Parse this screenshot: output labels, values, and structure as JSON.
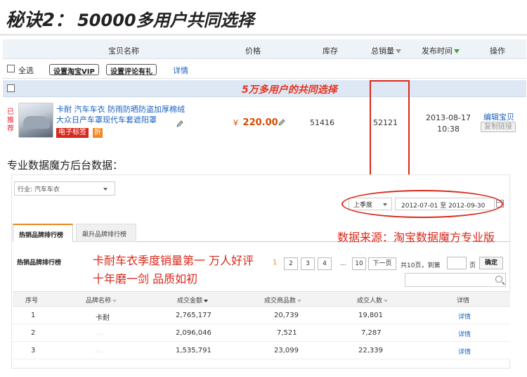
{
  "header": {
    "prefix": "秘诀2：",
    "title": "50000多用户共同选择"
  },
  "product_table": {
    "columns": {
      "name": "宝贝名称",
      "price": "价格",
      "stock": "库存",
      "sales": "总销量",
      "published": "发布时间",
      "actions": "操作"
    },
    "toolbar": {
      "select_all": "全选",
      "btn_vip": "设置淘宝VIP",
      "btn_review": "设置评论有礼",
      "details_link": "详情"
    },
    "band_text": "5万多用户的共同选择",
    "item": {
      "recommended": "已推荐",
      "title_line1": "卡耐 汽车车衣 防雨防晒防盗加厚棉绒",
      "title_line2": "大众日产车罩现代车套遮阳罩",
      "tag_label": "电子标签",
      "tag_discount": "折",
      "price_symbol": "￥",
      "price": "220.00",
      "stock": "51416",
      "sales": "52121",
      "date": "2013-08-17",
      "time": "10:38",
      "edit_link": "编辑宝贝",
      "copy_button": "复制链接"
    }
  },
  "magic_section": {
    "label": "专业数据魔方后台数据：",
    "industry_select": "行业: 汽车车衣",
    "period_select": "上季度",
    "date_from": "2012-07-01",
    "date_to_label": "至",
    "date_to": "2012-09-30",
    "tabs": [
      "热销品牌排行榜",
      "飙升品牌排行榜"
    ],
    "source_note": "数据来源：淘宝数据魔方专业版",
    "list_title": "热销品牌排行榜",
    "promo_line1": "卡耐车衣季度销量第一 万人好评",
    "promo_line2": "十年磨一剑 品质如初",
    "pager": {
      "current": "1",
      "pages": [
        "2",
        "3",
        "4"
      ],
      "dots": "...",
      "last": "10",
      "next": "下一页",
      "total": "共10页，到第",
      "page_unit": "页",
      "ok": "确定"
    },
    "table": {
      "headers": [
        "序号",
        "品牌名称",
        "成交金额",
        "成交商品数",
        "成交人数",
        "详情"
      ],
      "rows": [
        {
          "rank": "1",
          "brand": "卡耐",
          "amount": "2,765,177",
          "items": "20,739",
          "buyers": "19,801",
          "detail": "详情"
        },
        {
          "rank": "2",
          "brand": "…",
          "amount": "2,096,046",
          "items": "7,521",
          "buyers": "7,287",
          "detail": "详情"
        },
        {
          "rank": "3",
          "brand": "…",
          "amount": "1,535,791",
          "items": "23,099",
          "buyers": "22,339",
          "detail": "详情"
        }
      ]
    }
  },
  "colors": {
    "highlight_red": "#d8281b",
    "link_blue": "#1a62c2",
    "price_orange": "#d84a00",
    "header_bg": "#eef3f8",
    "band_bg": "#dde8f4"
  }
}
